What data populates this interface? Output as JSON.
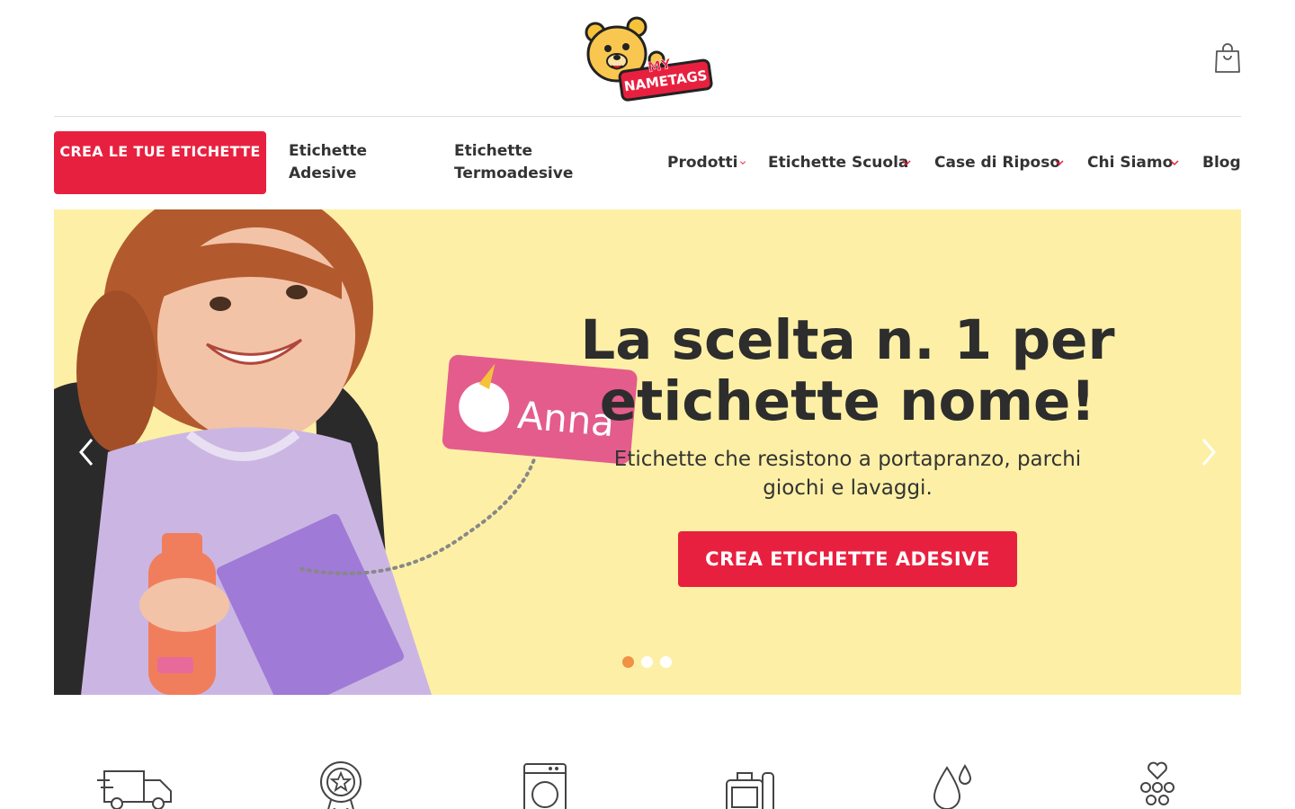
{
  "header": {
    "logo": {
      "line1": "MY",
      "line2": "NAMETAGS",
      "icon": "bear-logo-icon"
    },
    "cart_icon": "shopping-bag-icon"
  },
  "nav": {
    "cta_label": "CREA LE TUE ETICHETTE",
    "items": [
      {
        "label": "Etichette Adesive",
        "has_dropdown": false
      },
      {
        "label": "Etichette Termoadesive",
        "has_dropdown": false
      },
      {
        "label": "Prodotti",
        "has_dropdown": true
      },
      {
        "label": "Etichette Scuola",
        "has_dropdown": true
      },
      {
        "label": "Case di Riposo",
        "has_dropdown": true
      },
      {
        "label": "Chi Siamo",
        "has_dropdown": true
      },
      {
        "label": "Blog",
        "has_dropdown": false
      }
    ]
  },
  "hero": {
    "title": "La scelta n. 1 per etichette nome!",
    "subtitle": "Etichette che resistono a portapranzo, parchi giochi e lavaggi.",
    "cta_label": "CREA ETICHETTE ADESIVE",
    "tag_name": "Anna",
    "slide_count": 3,
    "active_slide": 1
  },
  "features": {
    "icons": [
      "delivery-truck-icon",
      "award-badge-icon",
      "washing-machine-icon",
      "lunchbox-icon",
      "water-drop-icon",
      "family-heart-icon"
    ]
  },
  "colors": {
    "brand_red": "#e8203f",
    "hero_bg": "#fdf0a6",
    "dot_active": "#f09144",
    "text_dark": "#2d2d2d"
  }
}
